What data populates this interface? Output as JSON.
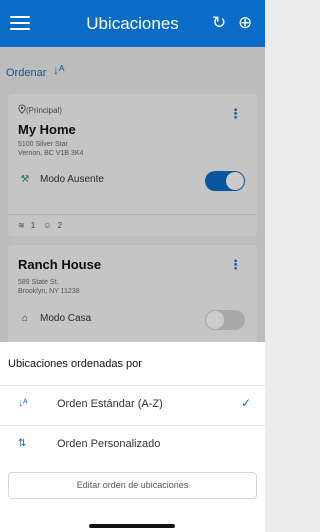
{
  "header": {
    "title": "Ubicaciones",
    "menu_icon": "hamburger-icon",
    "refresh_icon": "refresh-icon",
    "add_icon": "add-circle-icon"
  },
  "sort": {
    "label": "Ordenar",
    "icon": "sort-az-icon"
  },
  "locations": [
    {
      "tag": "(Principal)",
      "name": "My Home",
      "address_line1": "5100 Silver Star",
      "address_line2": "Vernon, BC V1B 3K4",
      "mode": "Modo Ausente",
      "mode_icon": "away-mode-icon",
      "toggle_on": true,
      "wifi_count": "1",
      "people_count": "2"
    },
    {
      "name": "Ranch House",
      "address_line1": "589 State St.",
      "address_line2": "Brooklyn, NY 11238",
      "mode": "Modo Casa",
      "mode_icon": "home-icon",
      "toggle_on": false
    }
  ],
  "sheet": {
    "title": "Ubicaciones ordenadas por",
    "options": [
      {
        "label": "Orden Estándar (A-Z)",
        "icon": "sort-az-icon",
        "selected": true
      },
      {
        "label": "Orden Personalizado",
        "icon": "custom-order-icon",
        "selected": false
      }
    ],
    "edit_label": "Editar orden de ubicaciones"
  },
  "colors": {
    "primary": "#0a6cc7",
    "accent_text": "#1b67c4",
    "away_green": "#2e9a4a"
  }
}
